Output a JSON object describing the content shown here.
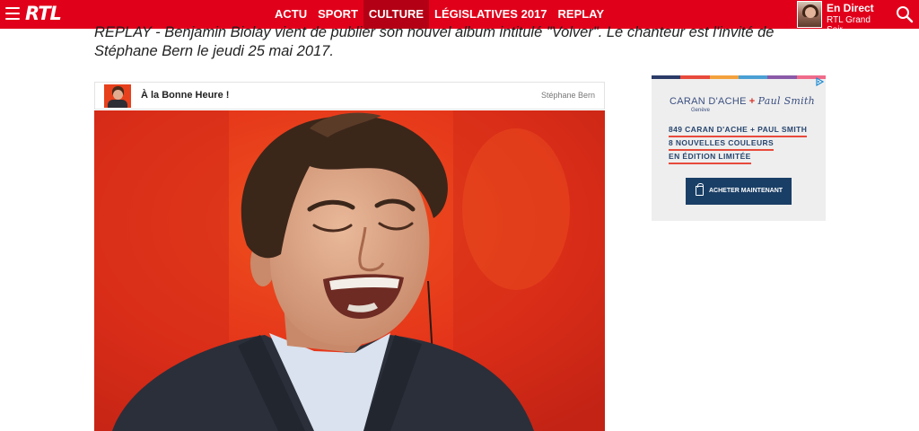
{
  "header": {
    "logo_text": "RTL",
    "nav": [
      {
        "label": "ACTU"
      },
      {
        "label": "SPORT"
      },
      {
        "label": "CULTURE",
        "active": true
      },
      {
        "label": "LÉGISLATIVES 2017"
      },
      {
        "label": "REPLAY"
      }
    ],
    "live_title": "En Direct",
    "live_subtitle": "RTL Grand Soir",
    "brand_color": "#e1001a",
    "icons": [
      "hamburger-menu-icon",
      "search-icon"
    ]
  },
  "article": {
    "intro": "REPLAY - Benjamin Biolay vient de publier son nouvel album intitulé \"Volver\". Le chanteur est l'invité de Stéphane Bern le jeudi 25 mai 2017."
  },
  "episode": {
    "title": "À la Bonne Heure !",
    "author": "Stéphane Bern"
  },
  "ad": {
    "brand_left": "CARAN D'ACHE",
    "brand_plus": "+",
    "brand_right": "Paul Smith",
    "brand_city": "Genève",
    "lines": [
      "849 CARAN D'ACHE + PAUL SMITH",
      "8 NOUVELLES COULEURS",
      "EN ÉDITION LIMITÉE"
    ],
    "button_label": "ACHETER MAINTENANT",
    "stripe_colors": [
      "#2b3a67",
      "#e84a3c",
      "#f3a13c",
      "#4a9fd4",
      "#8a5aa8",
      "#f06b8a"
    ],
    "icons": [
      "adchoices-icon",
      "shopping-bag-icon"
    ]
  }
}
